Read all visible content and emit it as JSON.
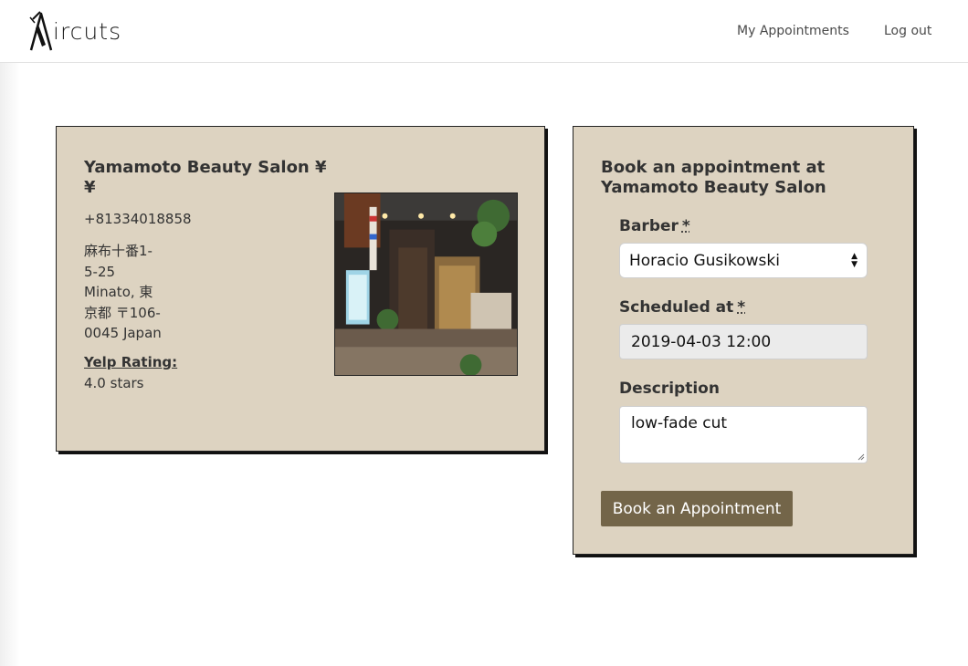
{
  "nav": {
    "brand": "ircuts",
    "my_appointments": "My Appointments",
    "logout": "Log out"
  },
  "salon": {
    "name": "Yamamoto Beauty Salon ¥¥",
    "phone": "+81334018858",
    "address_lines": [
      "麻布十番1-",
      "5-25",
      "Minato, 東",
      "京都 〒106-",
      "0045 Japan"
    ],
    "rating_label": "Yelp Rating:",
    "rating_value": "4.0 stars"
  },
  "booking": {
    "title": "Book an appointment at Yamamoto Beauty Salon",
    "barber_label": "Barber",
    "barber_required": "*",
    "barber_value": "Horacio Gusikowski",
    "scheduled_label": "Scheduled at",
    "scheduled_required": "*",
    "scheduled_value": "2019-04-03 12:00",
    "description_label": "Description",
    "description_value": "low-fade cut",
    "submit_label": "Book an Appointment"
  },
  "colors": {
    "card_bg": "#ddd3c1",
    "button_bg": "#736549"
  }
}
